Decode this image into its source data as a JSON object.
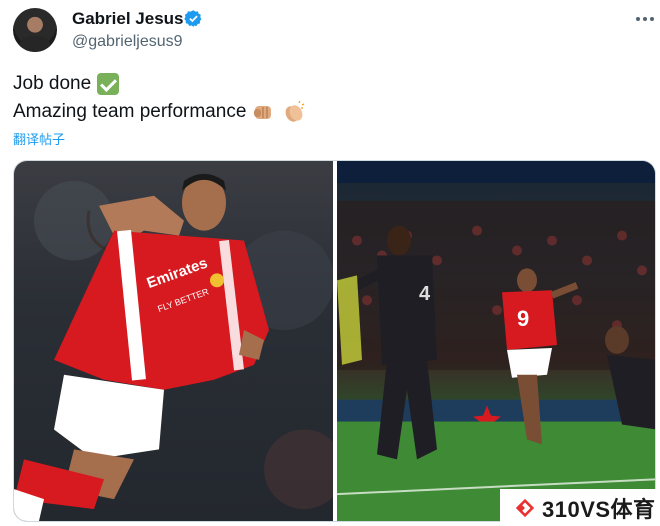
{
  "author": {
    "display_name": "Gabriel Jesus",
    "handle": "@gabrieljesus9",
    "verified": true
  },
  "tweet": {
    "line1": "Job done",
    "line1_emoji": "check-mark-button",
    "line2": "Amazing team performance",
    "line2_emojis": [
      "oncoming-fist",
      "clapping-hands"
    ],
    "translate_label": "翻译帖子"
  },
  "media": {
    "left_photo": {
      "shirt_sponsor": "Emirates",
      "shirt_sponsor_2": "FLY BETTER"
    },
    "right_photo": {
      "player_number": "9",
      "opponent_number": "4"
    }
  },
  "watermark": {
    "text": "310VS体育"
  },
  "colors": {
    "verified_blue": "#1d9bf0",
    "link_blue": "#1d9bf0",
    "arsenal_red": "#d71920",
    "watermark_red": "#e8322f"
  }
}
